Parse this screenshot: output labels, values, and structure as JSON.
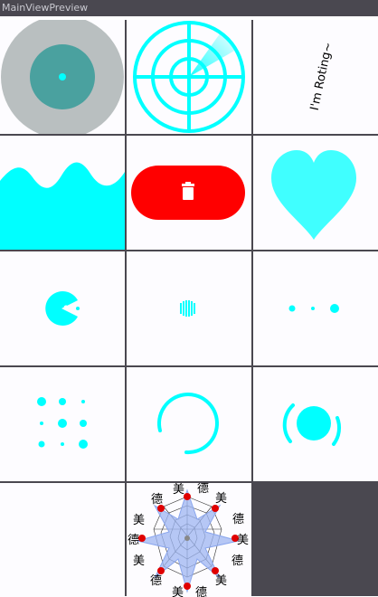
{
  "window": {
    "title": "MainViewPreview"
  },
  "cells": {
    "rotating_text": "I'm Roting~",
    "delete_icon": "trash-icon",
    "radar_glyphs_a": "美",
    "radar_glyphs_b": "德"
  },
  "colors": {
    "accent": "#00ffff",
    "gray_disc": "#b9bfc0",
    "teal_disc": "#4aa19f",
    "delete_red": "#ff0000",
    "heart": "#40ffff",
    "radar_fill": "#9db6f2",
    "dark_background": "#4a4850"
  }
}
